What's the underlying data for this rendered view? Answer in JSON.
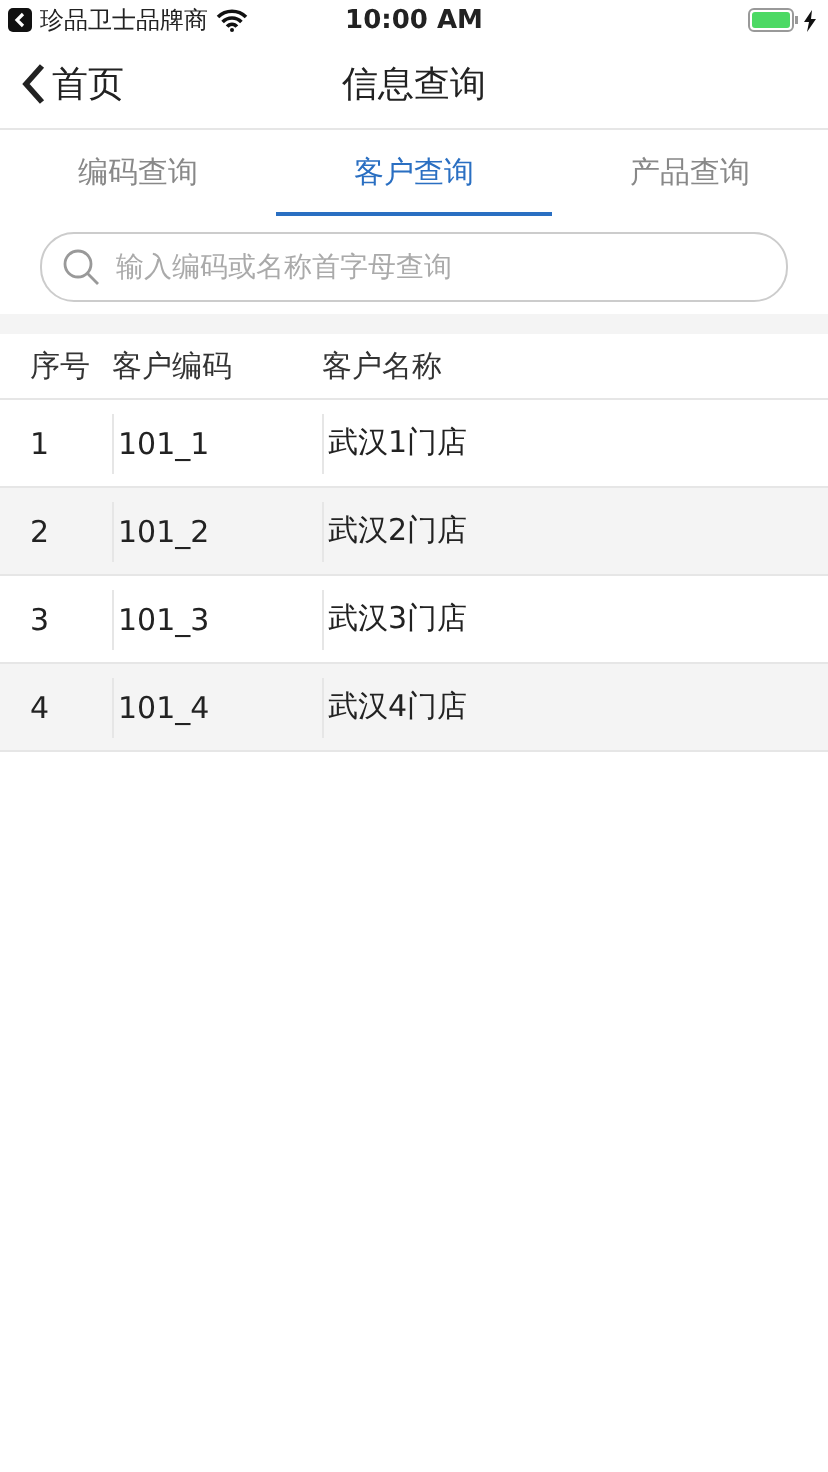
{
  "status_bar": {
    "back_app": "珍品卫士品牌商",
    "time": "10:00 AM"
  },
  "nav_bar": {
    "back": "首页",
    "title": "信息查询"
  },
  "tabs": [
    {
      "label": "编码查询",
      "selected": false
    },
    {
      "label": "客户查询",
      "selected": true
    },
    {
      "label": "产品查询",
      "selected": false
    }
  ],
  "search": {
    "placeholder": "输入编码或名称首字母查询"
  },
  "table": {
    "columns": [
      "序号",
      "客户编码",
      "客户名称"
    ],
    "rows": [
      [
        "1",
        "101_1",
        "武汉1门店"
      ],
      [
        "2",
        "101_2",
        "武汉2门店"
      ],
      [
        "3",
        "101_3",
        "武汉3门店"
      ],
      [
        "4",
        "101_4",
        "武汉4门店"
      ]
    ]
  }
}
